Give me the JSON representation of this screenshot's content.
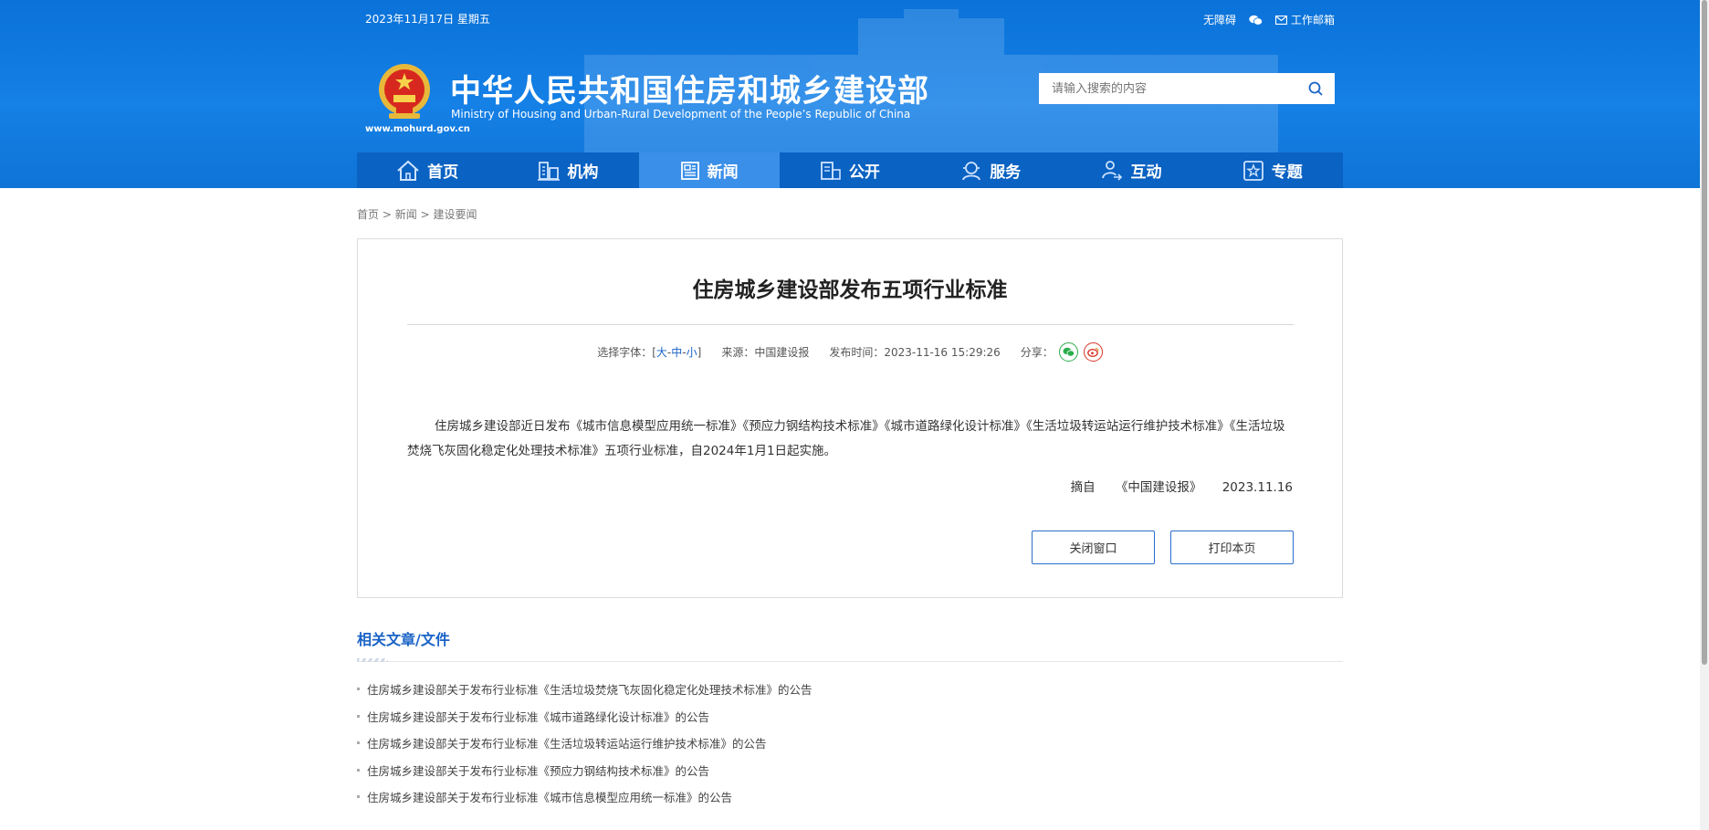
{
  "header": {
    "date": "2023年11月17日 星期五",
    "accessibility_label": "无障碍",
    "mail_label": "工作邮箱",
    "title_cn": "中华人民共和国住房和城乡建设部",
    "title_en": "Ministry of Housing and Urban-Rural Development of the People’s Republic of China",
    "domain": "www.mohurd.gov.cn",
    "search_placeholder": "请输入搜索的内容"
  },
  "nav": {
    "items": [
      {
        "label": "首页",
        "icon": "home-icon"
      },
      {
        "label": "机构",
        "icon": "building-icon"
      },
      {
        "label": "新闻",
        "icon": "news-icon",
        "active": true
      },
      {
        "label": "公开",
        "icon": "document-icon"
      },
      {
        "label": "服务",
        "icon": "service-icon"
      },
      {
        "label": "互动",
        "icon": "interact-icon"
      },
      {
        "label": "专题",
        "icon": "star-icon"
      }
    ]
  },
  "breadcrumb": {
    "home": "首页",
    "sep": ">",
    "news": "新闻",
    "current": "建设要闻"
  },
  "article": {
    "title": "住房城乡建设部发布五项行业标准",
    "font_label": "选择字体：[",
    "font_large": "大",
    "font_mid": "中",
    "font_small": "小",
    "font_sep": "-",
    "font_close": "]",
    "source": "来源：中国建设报",
    "publish_time": "发布时间：2023-11-16 15:29:26",
    "share_label": "分享：",
    "body": "住房城乡建设部近日发布《城市信息模型应用统一标准》《预应力钢结构技术标准》《城市道路绿化设计标准》《生活垃圾转运站运行维护技术标准》《生活垃圾焚烧飞灰固化稳定化处理技术标准》五项行业标准，自2024年1月1日起实施。",
    "excerpt_label": "摘自",
    "excerpt_source": "《中国建设报》",
    "excerpt_date": "2023.11.16",
    "close_button": "关闭窗口",
    "print_button": "打印本页"
  },
  "related": {
    "title": "相关文章/文件",
    "items": [
      "住房城乡建设部关于发布行业标准《生活垃圾焚烧飞灰固化稳定化处理技术标准》的公告",
      "住房城乡建设部关于发布行业标准《城市道路绿化设计标准》的公告",
      "住房城乡建设部关于发布行业标准《生活垃圾转运站运行维护技术标准》的公告",
      "住房城乡建设部关于发布行业标准《预应力钢结构技术标准》的公告",
      "住房城乡建设部关于发布行业标准《城市信息模型应用统一标准》的公告"
    ]
  },
  "colors": {
    "header_blue": "#1580e6",
    "nav_blue": "#0a62c2",
    "nav_active": "#3a8fe8",
    "link_blue": "#1a63c6",
    "wechat_green": "#2aae4c",
    "weibo_red": "#d9342b"
  }
}
